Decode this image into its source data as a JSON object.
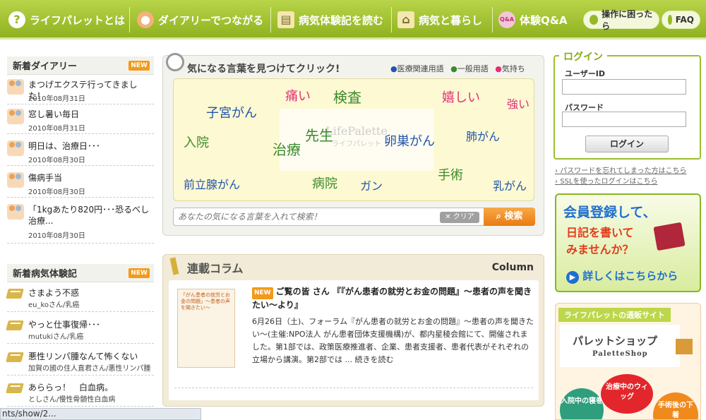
{
  "nav": {
    "items": [
      "ライフパレットとは",
      "ダイアリーでつながる",
      "病気体験記を読む",
      "病気と暮らし",
      "体験Q&A"
    ],
    "help": "操作に困ったら",
    "faq": "FAQ",
    "qa_icon": "Q&A"
  },
  "diary": {
    "title": "新着ダイアリー",
    "badge": "NEW",
    "items": [
      {
        "title": "まつげエクステ行ってきました！",
        "date": "2010年08月31日"
      },
      {
        "title": "窓し暑い毎日",
        "date": "2010年08月31日"
      },
      {
        "title": "明日は、治療日･･･",
        "date": "2010年08月30日"
      },
      {
        "title": "傷病手当",
        "date": "2010年08月30日"
      },
      {
        "title": "「1kgあたり820円･･･恐るべし治療...",
        "date": "2010年08月30日"
      }
    ]
  },
  "experience": {
    "title": "新着病気体験記",
    "badge": "NEW",
    "items": [
      {
        "title": "さまよう不惑",
        "sub": "eu_koさん/乳癌"
      },
      {
        "title": "やっと仕事復帰･･･",
        "sub": "mutukiさん/乳癌"
      },
      {
        "title": "悪性リンパ腫なんて怖くない",
        "sub": "加賀の國の住人直君さん/悪性リンパ腫"
      },
      {
        "title": "あららっ！　白血病。",
        "sub": "としさん/慢性骨髄性白血病"
      }
    ]
  },
  "keywords": {
    "title": "気になる言葉を見つけてクリック!",
    "legend": [
      "医療関連用語",
      "一般用語",
      "気持ち"
    ],
    "words": [
      "痛い",
      "検査",
      "嬉しい",
      "強い",
      "子宮がん",
      "先生",
      "入院",
      "治療",
      "卵巣がん",
      "肺がん",
      "手術",
      "前立腺がん",
      "病院",
      "ガン",
      "乳がん"
    ],
    "watermark": {
      "main": "LifePalette",
      "sub": "ライフパレット"
    },
    "search": {
      "placeholder": "あなたの気になる言葉を入れて検索！",
      "clear": "クリア",
      "button": "検索"
    }
  },
  "column": {
    "title": "連載コラム",
    "label": "Column",
    "badge": "NEW",
    "headline": "ご覧の皆 さん 『『がん患者の就労とお金の問題』～患者の声を聞きたい～より』",
    "body": "6月26日（土)、フォーラム『がん患者の就労とお金の問題』～患者の声を聞きたい～(主催:NPO法人 がん患者団体支援機構)が、都内星稜会館にて、開催されました。第1部では、政策医療推進者、企業、患者支援者、患者代表がそれぞれの立場から講演。第2部では ... 続きを読む",
    "thumb": "「がん患者の就労とお金の問題」～患者の声を聞きたい～"
  },
  "login": {
    "title": "ログイン",
    "user_label": "ユーザーID",
    "pass_label": "パスワード",
    "button": "ログイン",
    "links": [
      "パスワードを忘れてしまった方はこちら",
      "SSLを使ったログインはこちら"
    ]
  },
  "register": {
    "lines": [
      "会員登録して、",
      "日記を書いて",
      "みませんか？"
    ],
    "link": "詳しくはこちらから"
  },
  "shop": {
    "title": "ライフパレットの通販サイト",
    "name": "パレットショップ",
    "en": "PaletteShop",
    "bubbles": [
      "入院中の寝巻",
      "治療中のウィッグ",
      "手術後の下着"
    ]
  },
  "status": "nts/show/2..."
}
